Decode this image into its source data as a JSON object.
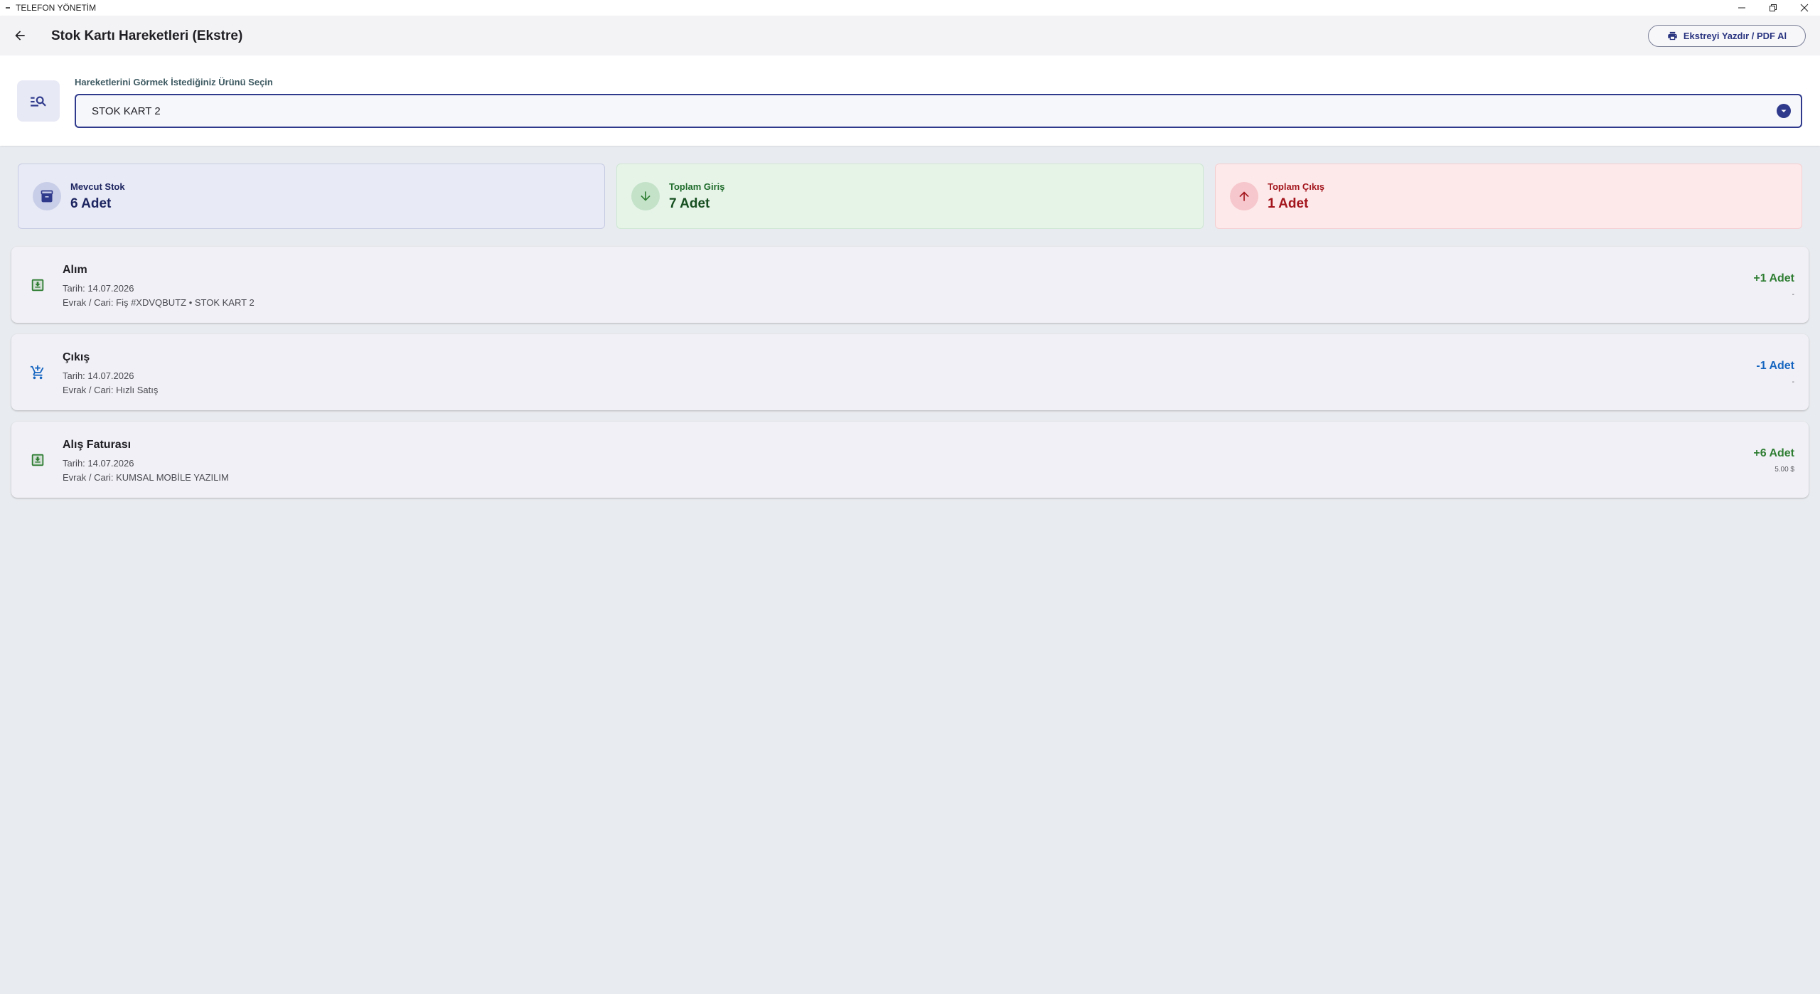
{
  "window": {
    "title": "TELEFON YÖNETİM"
  },
  "appbar": {
    "title": "Stok Kartı Hareketleri (Ekstre)",
    "print_label": "Ekstreyi Yazdır / PDF Al"
  },
  "product_select": {
    "label": "Hareketlerini Görmek İstediğiniz Ürünü Seçin",
    "value": "STOK KART 2"
  },
  "summary": {
    "stock": {
      "label": "Mevcut Stok",
      "value": "6 Adet"
    },
    "total_in": {
      "label": "Toplam Giriş",
      "value": "7 Adet"
    },
    "total_out": {
      "label": "Toplam Çıkış",
      "value": "1 Adet"
    }
  },
  "movements": [
    {
      "type": "Alım",
      "date": "Tarih: 14.07.2026",
      "doc": "Evrak / Cari: Fiş #XDVQBUTZ • STOK KART 2",
      "qty": "+1 Adet",
      "price": "-",
      "icon": "download-box-icon",
      "direction": "in"
    },
    {
      "type": "Çıkış",
      "date": "Tarih: 14.07.2026",
      "doc": "Evrak / Cari: Hızlı Satış",
      "qty": "-1 Adet",
      "price": "-",
      "icon": "cart-icon",
      "direction": "out"
    },
    {
      "type": "Alış Faturası",
      "date": "Tarih: 14.07.2026",
      "doc": "Evrak / Cari: KUMSAL MOBİLE YAZILIM",
      "qty": "+6 Adet",
      "price": "5.00 $",
      "icon": "download-box-icon",
      "direction": "in"
    }
  ],
  "colors": {
    "primary": "#2f3a8c",
    "in": "#2e7d32",
    "out": "#1565c0",
    "danger": "#a3151c"
  }
}
